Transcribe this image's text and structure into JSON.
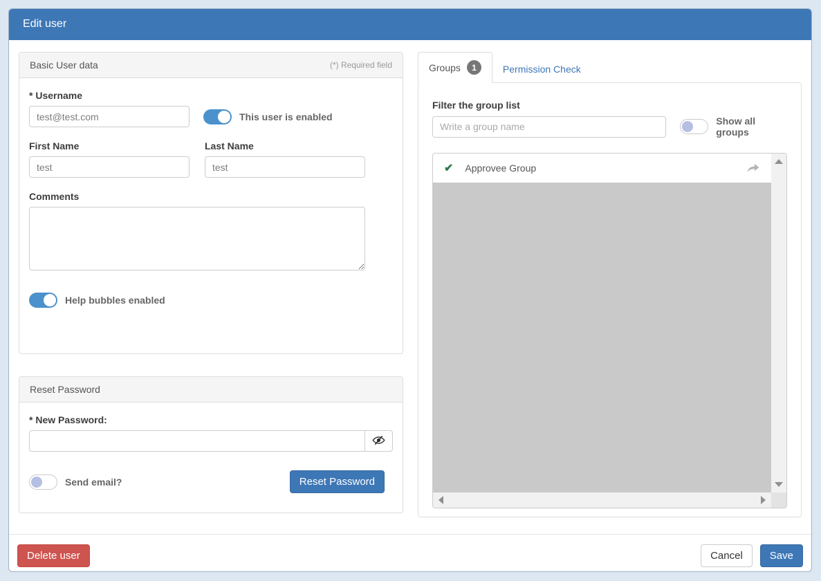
{
  "window": {
    "title": "Edit user"
  },
  "basic_panel": {
    "title": "Basic User data",
    "required_note": "(*) Required field",
    "username": {
      "label": "* Username",
      "value": "test@test.com"
    },
    "user_enabled_toggle": {
      "label": "This user is enabled",
      "state": "on"
    },
    "first_name": {
      "label": "First Name",
      "value": "test"
    },
    "last_name": {
      "label": "Last Name",
      "value": "test"
    },
    "comments": {
      "label": "Comments",
      "value": ""
    },
    "help_bubbles_toggle": {
      "label": "Help bubbles enabled",
      "state": "on"
    }
  },
  "reset_panel": {
    "title": "Reset Password",
    "new_password": {
      "label": "* New Password:",
      "value": ""
    },
    "show_password_icon": "eye-slash-icon",
    "send_email_toggle": {
      "label": "Send email?",
      "state": "off"
    },
    "reset_button_label": "Reset Password"
  },
  "groups_panel": {
    "tabs": [
      {
        "label": "Groups",
        "badge": "1",
        "active": true
      },
      {
        "label": "Permission Check",
        "active": false
      }
    ],
    "filter": {
      "label": "Filter the group list",
      "placeholder": "Write a group name"
    },
    "show_all_toggle": {
      "label": "Show all groups",
      "state": "off"
    },
    "groups": [
      {
        "name": "Approvee Group",
        "checked": true,
        "check_icon": "checkmark-icon",
        "action_icon": "share-arrow-icon"
      }
    ]
  },
  "footer": {
    "delete_label": "Delete user",
    "cancel_label": "Cancel",
    "save_label": "Save"
  },
  "colors": {
    "header_blue": "#3e77b6",
    "toggle_on_blue": "#4b92cc",
    "toggle_off_knob": "#b5bfe4",
    "danger_red": "#ce544f",
    "link_blue": "#3d76b4",
    "check_green": "#2f7a4d",
    "list_gray": "#c9c9c9",
    "page_background": "#dce7f2"
  }
}
